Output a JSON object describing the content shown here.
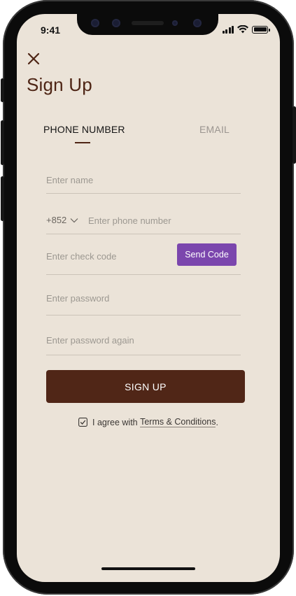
{
  "status_bar": {
    "time": "9:41"
  },
  "header": {
    "close_icon": "close-x-icon",
    "title": "Sign Up"
  },
  "tabs": {
    "items": [
      {
        "label": "PHONE NUMBER",
        "active": true
      },
      {
        "label": "EMAIL",
        "active": false
      }
    ]
  },
  "form": {
    "name_placeholder": "Enter name",
    "country_code": "+852",
    "phone_placeholder": "Enter phone number",
    "check_code_placeholder": "Enter check code",
    "send_code_label": "Send Code",
    "password_placeholder": "Enter password",
    "password_again_placeholder": "Enter password again"
  },
  "actions": {
    "signup_label": "SIGN UP"
  },
  "agreement": {
    "prefix": "I agree with ",
    "link_text": "Terms & Conditions",
    "suffix": ".",
    "checked": true
  },
  "colors": {
    "background": "#ebe3d8",
    "brand_brown": "#502617",
    "send_code_purple": "#7b46ad",
    "inactive_tab": "#9b9590"
  }
}
